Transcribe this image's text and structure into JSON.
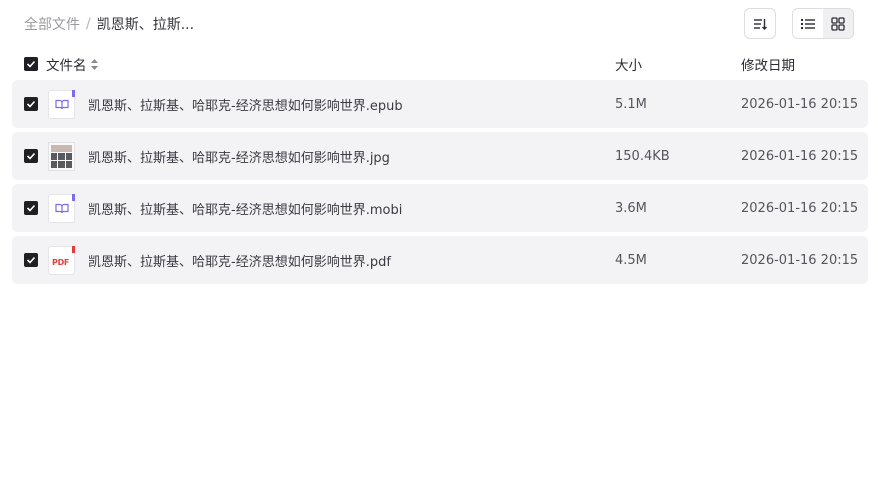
{
  "breadcrumb": {
    "root": "全部文件",
    "separator": "/",
    "current": "凯恩斯、拉斯..."
  },
  "toolbar": {
    "sort_icon": "sort-descending-icon",
    "list_view_icon": "list-view-icon",
    "grid_view_icon": "grid-view-icon",
    "active_view": "list"
  },
  "table": {
    "headers": {
      "name": "文件名",
      "size": "大小",
      "modified": "修改日期"
    },
    "select_all_checked": true,
    "rows": [
      {
        "name": "凯恩斯、拉斯基、哈耶克-经济思想如何影响世界.epub",
        "size": "5.1M",
        "modified": "2026-01-16 20:15",
        "icon": "ebook-icon",
        "checked": true
      },
      {
        "name": "凯恩斯、拉斯基、哈耶克-经济思想如何影响世界.jpg",
        "size": "150.4KB",
        "modified": "2026-01-16 20:15",
        "icon": "image-thumbnail",
        "checked": true
      },
      {
        "name": "凯恩斯、拉斯基、哈耶克-经济思想如何影响世界.mobi",
        "size": "3.6M",
        "modified": "2026-01-16 20:15",
        "icon": "ebook-icon",
        "checked": true
      },
      {
        "name": "凯恩斯、拉斯基、哈耶克-经济思想如何影响世界.pdf",
        "size": "4.5M",
        "modified": "2026-01-16 20:15",
        "icon": "pdf-icon",
        "checked": true
      }
    ]
  },
  "icon_labels": {
    "pdf": "PDF"
  },
  "colors": {
    "row_bg": "#f3f3f5",
    "checkbox": "#1f1f24",
    "ebook_accent": "#7b6cf0",
    "pdf_accent": "#e63b3b"
  }
}
